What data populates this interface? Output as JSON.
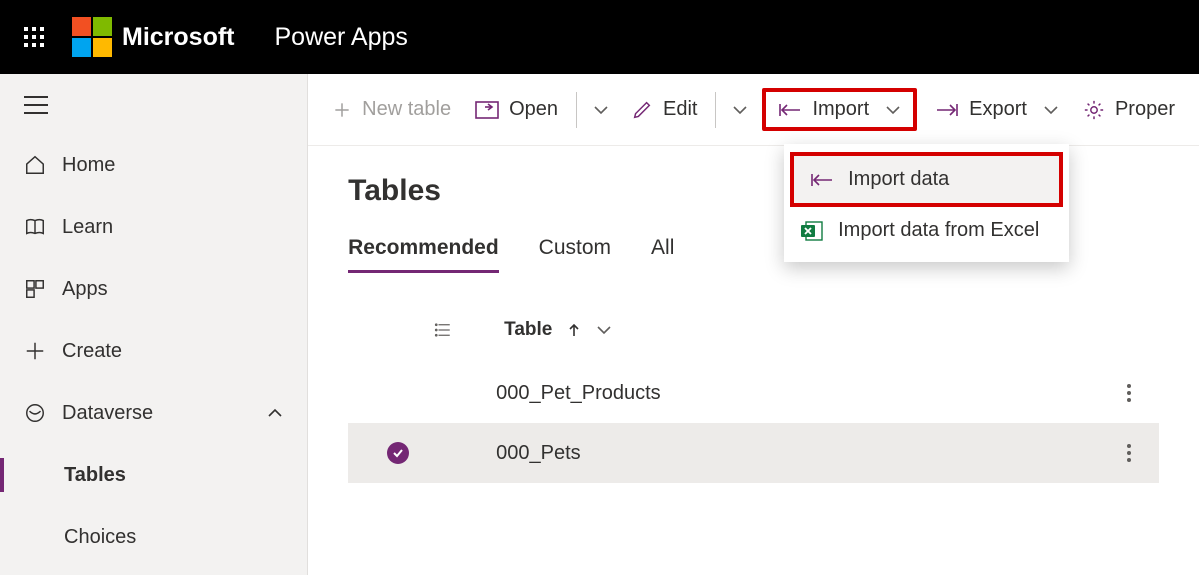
{
  "header": {
    "brand": "Microsoft",
    "app": "Power Apps"
  },
  "sidebar": {
    "items": [
      {
        "label": "Home"
      },
      {
        "label": "Learn"
      },
      {
        "label": "Apps"
      },
      {
        "label": "Create"
      },
      {
        "label": "Dataverse"
      },
      {
        "label": "Tables"
      },
      {
        "label": "Choices"
      }
    ]
  },
  "toolbar": {
    "new_table": "New table",
    "open": "Open",
    "edit": "Edit",
    "import": "Import",
    "export": "Export",
    "properties": "Proper"
  },
  "dropdown": {
    "import_data": "Import data",
    "import_excel": "Import data from Excel"
  },
  "page": {
    "title": "Tables",
    "tabs": {
      "recommended": "Recommended",
      "custom": "Custom",
      "all": "All"
    },
    "column_label": "Table",
    "rows": [
      {
        "name": "000_Pet_Products"
      },
      {
        "name": "000_Pets"
      }
    ]
  }
}
